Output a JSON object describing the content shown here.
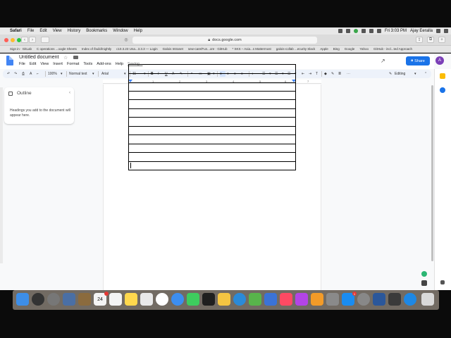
{
  "menubar": {
    "app": "Safari",
    "items": [
      "File",
      "Edit",
      "View",
      "History",
      "Bookmarks",
      "Window",
      "Help"
    ],
    "clock": "Fri 3:03 PM",
    "user": "Ajay Eeralla"
  },
  "browser": {
    "url": "docs.google.com",
    "bookmarks": [
      "Sign in · GitLab",
      "C operations ...oogle Sheets",
      "Index of /build/nightly",
      "c10.3.23 Una...3.3.3 — Login",
      "Galois Intranet",
      "sew-care/Fun...ore · GitHub",
      "* SKS – Axia...s Mattermost",
      "galois-collab ...ecurity Slack",
      "Apple",
      "Bing",
      "Google",
      "Yahoo",
      "GitHub - incl...ted Approach"
    ]
  },
  "docs": {
    "title": "Untitled document",
    "menu": [
      "File",
      "Edit",
      "View",
      "Insert",
      "Format",
      "Tools",
      "Add-ons",
      "Help",
      "Saving..."
    ],
    "share_label": "Share",
    "avatar_initial": "A",
    "toolbar": {
      "zoom": "100%",
      "style": "Normal text",
      "font": "Arial",
      "size": "11",
      "mode": "Editing",
      "bold": "B",
      "italic": "I",
      "underline": "U",
      "text_color": "A"
    },
    "ruler_numbers": [
      "1",
      "1",
      "2",
      "3",
      "4",
      "5",
      "6",
      "7"
    ],
    "outline": {
      "title": "Outline",
      "hint": "Headings you add to the document will appear here."
    },
    "table": {
      "rows": 12,
      "cols": 1
    }
  },
  "dock": {
    "badges": {
      "calendar_date": "24",
      "mail_count": "1",
      "appstore_count": "1"
    }
  }
}
